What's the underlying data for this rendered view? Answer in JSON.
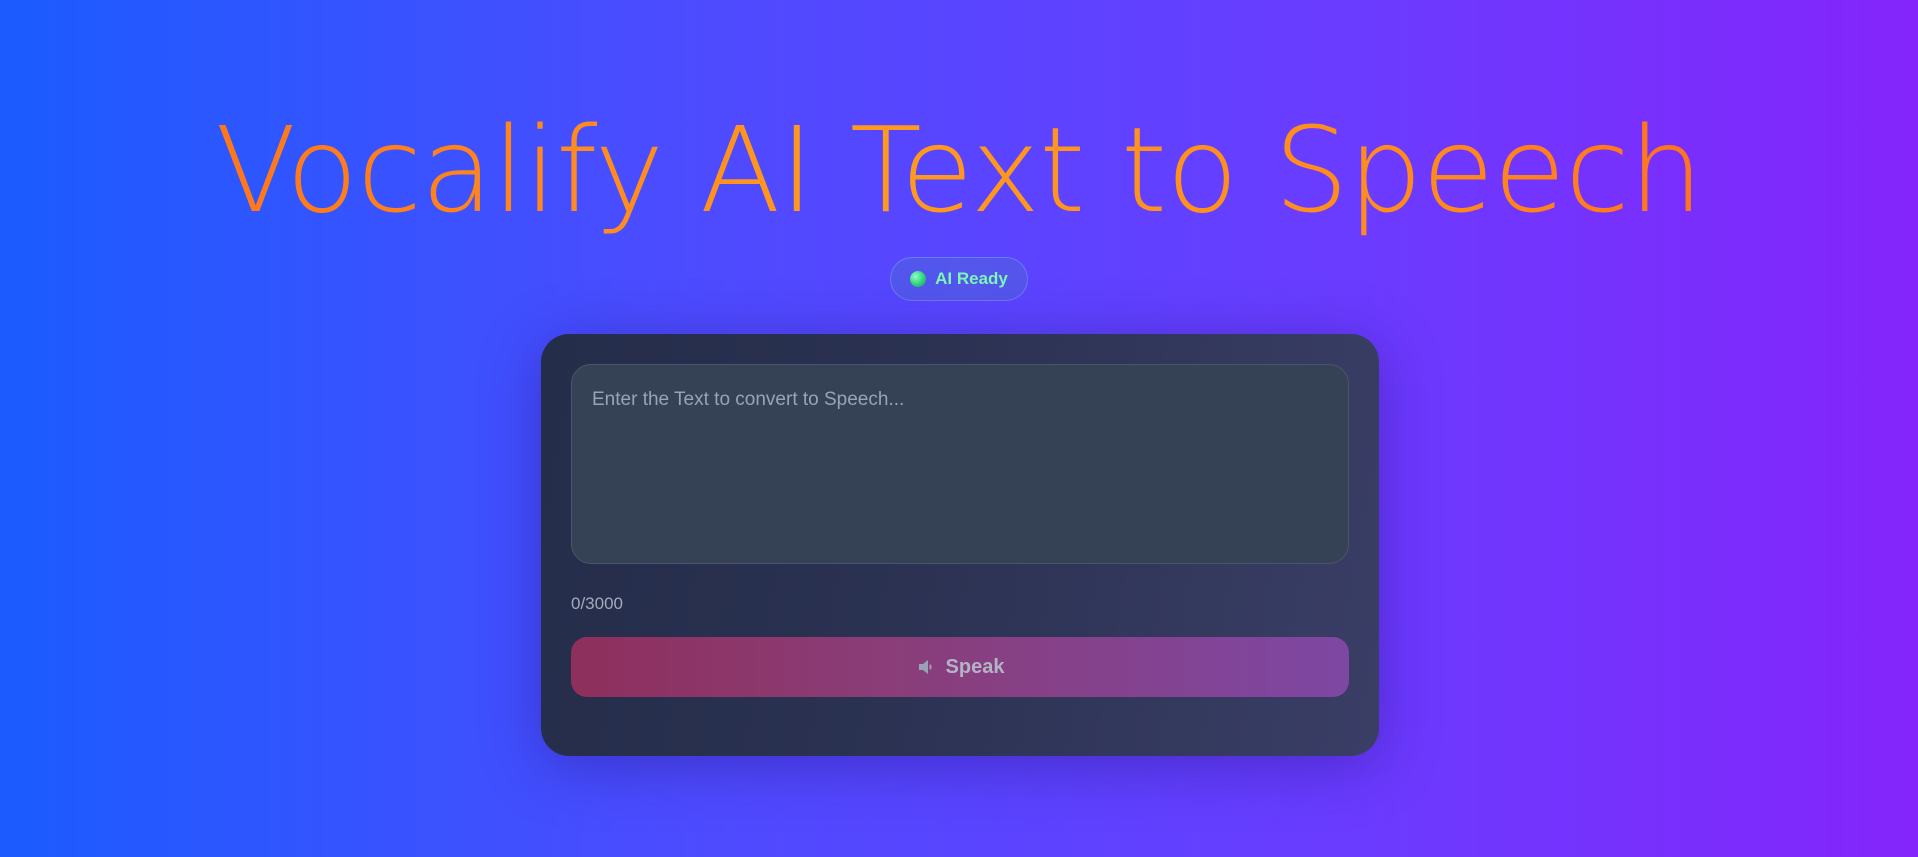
{
  "header": {
    "title": "Vocalify AI Text to Speech"
  },
  "status": {
    "label": "AI Ready",
    "color": "#7cf7b6"
  },
  "input": {
    "placeholder": "Enter the Text to convert to Speech...",
    "value": ""
  },
  "counter": {
    "text": "0/3000"
  },
  "actions": {
    "speak_label": "Speak",
    "speak_icon": "speaker-icon"
  },
  "colors": {
    "title_gradient_start": "#ff6a1a",
    "title_gradient_end": "#ff9a1f",
    "button_gradient_start": "#8e2f5c",
    "button_gradient_end": "#7e47a3"
  }
}
